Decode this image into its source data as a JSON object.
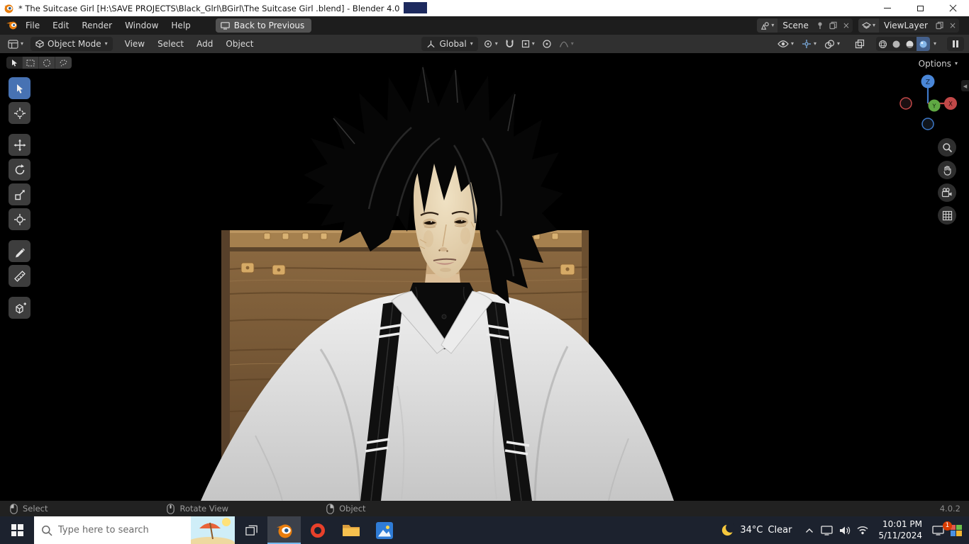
{
  "titlebar": {
    "title": "* The Suitcase Girl  [H:\\SAVE PROJECTS\\Black_Glrl\\BGirl\\The Suitcase Girl .blend] - Blender 4.0"
  },
  "topbar": {
    "menus": [
      "File",
      "Edit",
      "Render",
      "Window",
      "Help"
    ],
    "back_button": "Back to Previous",
    "scene": {
      "label": "Scene"
    },
    "view_layer": {
      "label": "ViewLayer"
    }
  },
  "tool_header": {
    "mode_selector": "Object Mode",
    "menus": [
      "View",
      "Select",
      "Add",
      "Object"
    ],
    "orientation": "Global"
  },
  "viewport": {
    "options_label": "Options",
    "gizmo": {
      "x": "X",
      "y": "Y",
      "z": "Z"
    }
  },
  "status_bar": {
    "hints": [
      {
        "button": "left-mouse",
        "label": "Select"
      },
      {
        "button": "middle-mouse",
        "label": "Rotate View"
      },
      {
        "button": "right-mouse",
        "label": "Object"
      }
    ],
    "version": "4.0.2"
  },
  "taskbar": {
    "search": {
      "placeholder": "Type here to search"
    },
    "weather": {
      "temperature": "34°C",
      "condition": "Clear"
    },
    "clock": {
      "time": "10:01 PM",
      "date": "5/11/2024"
    },
    "notification_badge": "1"
  },
  "icons": {
    "chevron_down": "▾",
    "collapse_left": "◂",
    "close_x": "×"
  },
  "colors": {
    "accent_blue": "#4772b3",
    "blender_orange": "#e87d0d",
    "topbar_bg": "#1d1d1d",
    "header_bg": "#303030",
    "viewport_bg": "#000000",
    "taskbar_bg": "#1c222e",
    "titlebar_bg": "#ffffff"
  }
}
